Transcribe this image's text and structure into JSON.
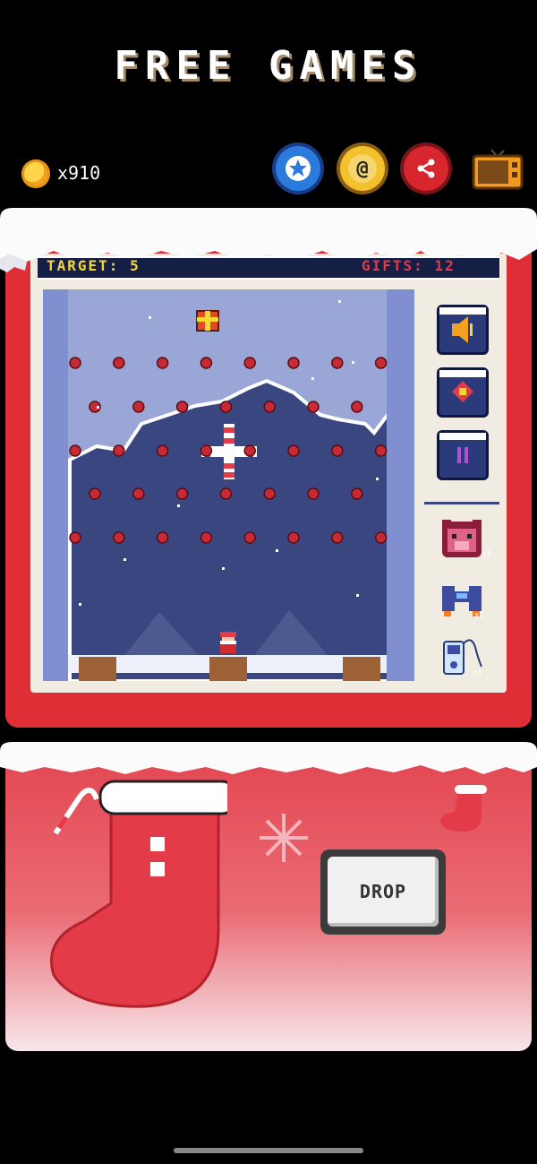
{
  "header": {
    "title": "FREE GAMES"
  },
  "coins": {
    "count": "x910",
    "icon": "coin-icon"
  },
  "toolbar": {
    "buttons": [
      {
        "name": "star-button",
        "icon": "star-icon",
        "color": "#2b7bdc"
      },
      {
        "name": "contact-button",
        "icon": "at-icon",
        "glyph": "@",
        "color": "#f3c12d"
      },
      {
        "name": "share-button",
        "icon": "share-icon",
        "color": "#d7262d"
      },
      {
        "name": "tv-button",
        "icon": "tv-icon",
        "color": "#f19a20"
      }
    ]
  },
  "hud": {
    "target": "TARGET: 5",
    "gifts": "GIFTS:  12"
  },
  "side_panel": {
    "buttons": [
      {
        "name": "sound-button",
        "icon": "speaker-icon"
      },
      {
        "name": "ornament-button",
        "icon": "ornament-icon"
      },
      {
        "name": "pause-button",
        "icon": "pause-icon"
      }
    ],
    "powerups": [
      {
        "name": "boar-powerup",
        "icon": "boar-icon",
        "count": "x1"
      },
      {
        "name": "rocket-powerup",
        "icon": "rocket-icon",
        "count": "x1"
      },
      {
        "name": "gadget-powerup",
        "icon": "gadget-icon",
        "count": "x1"
      }
    ]
  },
  "controls": {
    "drop_label": "DROP"
  },
  "colors": {
    "machine_red": "#e02e36",
    "hud_bg": "#151e45",
    "target_yellow": "#f6d833",
    "gifts_red": "#e33b48",
    "sky": "#9aa6d6",
    "night": "#3a4680"
  }
}
